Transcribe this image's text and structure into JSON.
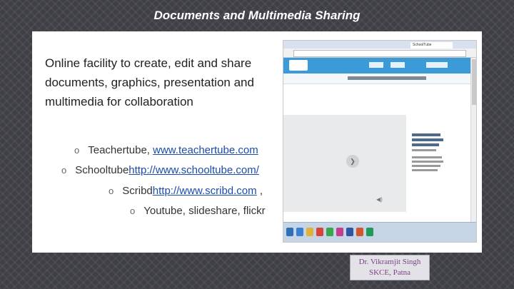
{
  "slide": {
    "title": "Documents and Multimedia Sharing",
    "intro_lines": [
      "Online facility to create,  edit and share",
      "documents, graphics, presentation and",
      "multimedia for collaboration"
    ],
    "bullets": [
      {
        "marker": "o",
        "text": "Teachertube, ",
        "link": "www.teachertube.com"
      },
      {
        "marker": "o",
        "text": "Schooltube",
        "link": "http://www.schooltube.com/"
      },
      {
        "marker": "o",
        "text": "Scribd",
        "link": "http://www.scribd.com",
        "suffix": " ,"
      },
      {
        "marker": "o",
        "text": "Youtube, slideshare, flickr"
      }
    ]
  },
  "screenshot": {
    "tab_title": "SchoolTube",
    "play_symbol": "❯",
    "volume_symbol": "◀)"
  },
  "author_badge": {
    "line1": "Dr. Vikramjit Singh",
    "line2": "SKCE, Patna"
  },
  "colors": {
    "background": "#3f3f46",
    "link": "#1a4dab",
    "site_header": "#3a9bd8",
    "badge_text": "#7b3f88"
  }
}
